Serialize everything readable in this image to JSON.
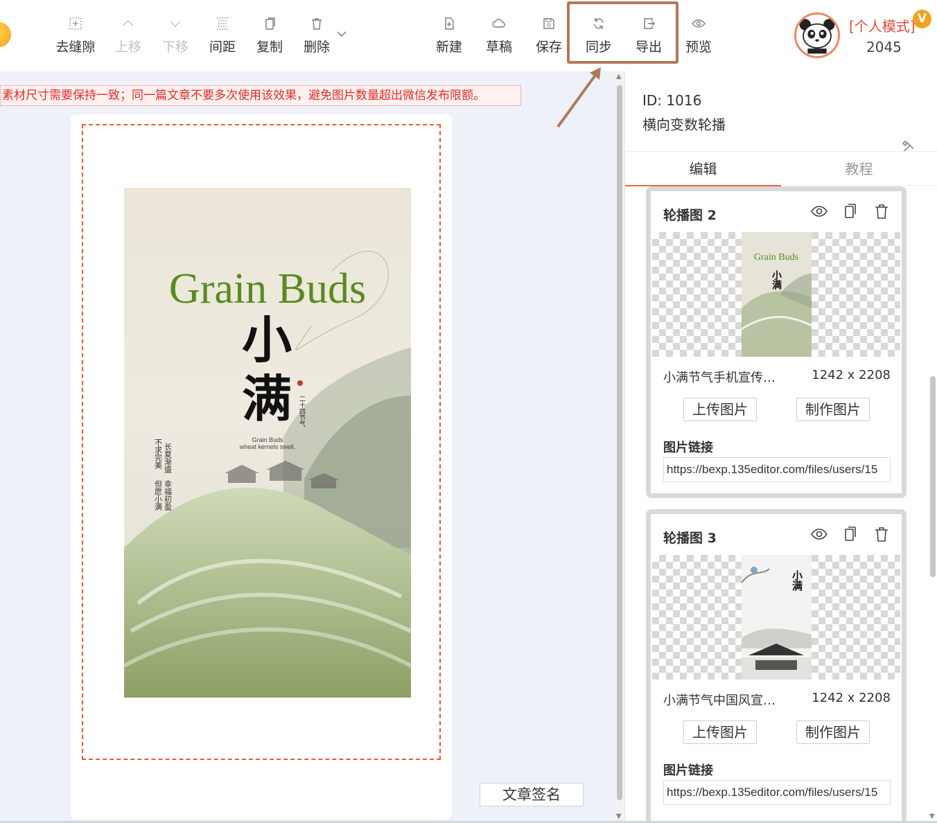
{
  "toolbar": {
    "left_buttons": [
      {
        "label": "去缝隙",
        "icon": "grid-gap-icon",
        "disabled": false
      },
      {
        "label": "上移",
        "icon": "chevron-up-icon",
        "disabled": true
      },
      {
        "label": "下移",
        "icon": "chevron-down-icon",
        "disabled": true
      },
      {
        "label": "间距",
        "icon": "spacing-icon",
        "disabled": false
      },
      {
        "label": "复制",
        "icon": "copy-icon",
        "disabled": false
      },
      {
        "label": "删除",
        "icon": "trash-icon",
        "disabled": false
      }
    ],
    "right_buttons": [
      {
        "label": "新建",
        "icon": "new-file-icon"
      },
      {
        "label": "草稿",
        "icon": "cloud-icon"
      },
      {
        "label": "保存",
        "icon": "save-icon"
      },
      {
        "label": "同步",
        "icon": "sync-icon"
      },
      {
        "label": "导出",
        "icon": "export-icon"
      },
      {
        "label": "预览",
        "icon": "eye-icon"
      }
    ],
    "user": {
      "mode": "[个人模式]",
      "vip_badge": "V",
      "points": "2045"
    }
  },
  "canvas": {
    "notice": "素材尺寸需要保持一致；同一篇文章不要多次使用该效果，避免图片数量超出微信发布限额。",
    "poster": {
      "title_en": "Grain Buds",
      "title_cn_1": "小",
      "title_cn_2": "满",
      "sub_1": "Grain Buds",
      "sub_2": "wheat kernels swell.",
      "side_tag": "二十四节气",
      "poem": [
        "长夏渐盛",
        "不求完美",
        "幸福初盈",
        "但愿小满"
      ]
    },
    "signature_button": "文章签名"
  },
  "panel": {
    "id_line": "ID: 1016",
    "name": "横向变数轮播",
    "tabs": [
      "编辑",
      "教程"
    ],
    "cards": [
      {
        "title": "轮播图 2",
        "file_name": "小满节气手机宣传…",
        "dims": "1242 x 2208",
        "upload": "上传图片",
        "make": "制作图片",
        "link_label": "图片链接",
        "link": "https://bexp.135editor.com/files/users/15",
        "thumb_title": "Grain Buds",
        "thumb_cn": "小满"
      },
      {
        "title": "轮播图 3",
        "file_name": "小满节气中国风宣…",
        "dims": "1242 x 2208",
        "upload": "上传图片",
        "make": "制作图片",
        "link_label": "图片链接",
        "link": "https://bexp.135editor.com/files/users/15",
        "thumb_cn": "小满"
      }
    ]
  },
  "colors": {
    "accent": "#e36a3c",
    "selection": "#ef5a2d",
    "notice_text": "#e02e24",
    "highlight_box": "#b07a5a",
    "poster_green": "#5a8a1e"
  }
}
